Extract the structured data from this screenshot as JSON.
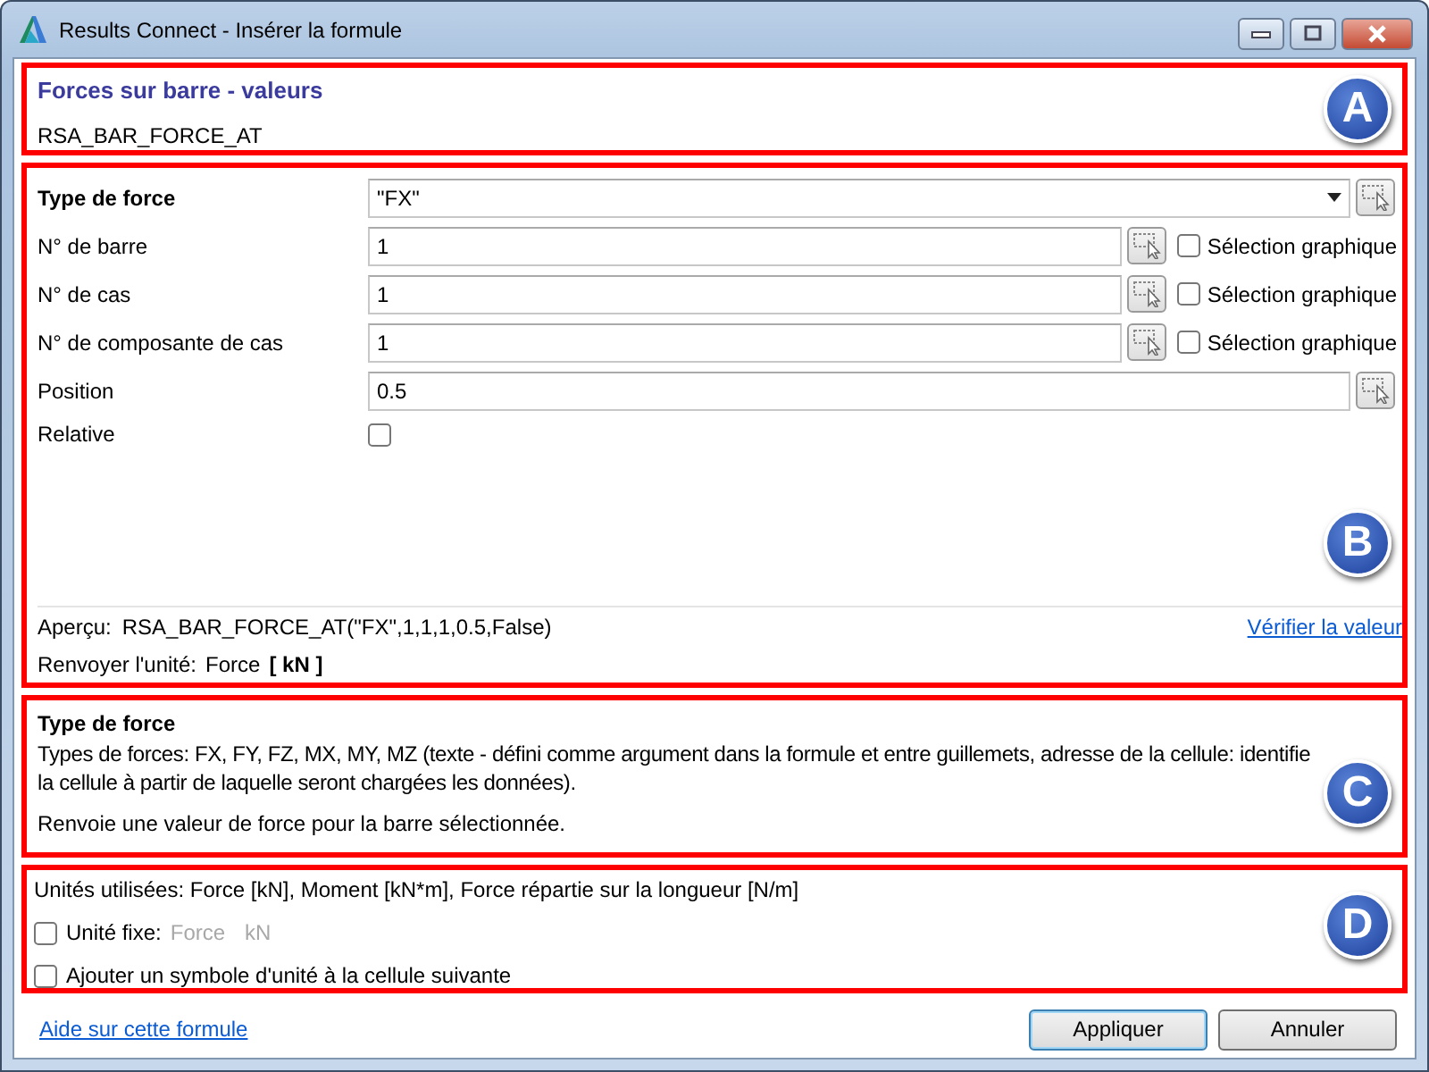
{
  "window": {
    "title": "Results Connect - Insérer la formule"
  },
  "header": {
    "title": "Forces sur barre - valeurs",
    "subtitle": "RSA_BAR_FORCE_AT",
    "callout": "A"
  },
  "parameters": {
    "callout": "B",
    "rows": [
      {
        "kind": "dropdown",
        "label": "Type de force",
        "value": "\"FX\""
      },
      {
        "kind": "field",
        "label": "N° de barre",
        "value": "1",
        "graphic_selection": {
          "label": "Sélection graphique",
          "checked": false
        }
      },
      {
        "kind": "field",
        "label": "N° de cas",
        "value": "1",
        "graphic_selection": {
          "label": "Sélection graphique",
          "checked": false
        }
      },
      {
        "kind": "field",
        "label": "N° de composante de cas",
        "value": "1",
        "graphic_selection": {
          "label": "Sélection graphique",
          "checked": false
        }
      },
      {
        "kind": "field",
        "label": "Position",
        "value": "0.5"
      },
      {
        "kind": "checkbox",
        "label": "Relative",
        "checked": false
      }
    ],
    "preview_label": "Aperçu:",
    "preview": "RSA_BAR_FORCE_AT(\"FX\",1,1,1,0.5,False)",
    "verify_link": "Vérifier la valeur",
    "unit_label": "Renvoyer l'unité:",
    "unit_name": "Force",
    "unit": "[ kN ]"
  },
  "description": {
    "callout": "C",
    "title": "Type de force",
    "text": "Types de forces: FX, FY, FZ, MX, MY, MZ (texte - défini comme argument dans la formule et entre guillemets, adresse de la cellule: identifie la cellule à partir de laquelle seront chargées les données).",
    "returns": "Renvoie une valeur de force pour la barre sélectionnée."
  },
  "units": {
    "callout": "D",
    "used": "Unités utilisées: Force [kN], Moment [kN*m], Force répartie sur la longueur [N/m]",
    "fixed_unit": {
      "label": "Unité fixe:",
      "checked": false,
      "disabled": true,
      "quantity": "Force",
      "unit": "kN"
    },
    "add_symbol": {
      "label": "Ajouter un symbole d'unité à la cellule suivante",
      "checked": false
    }
  },
  "footer": {
    "help_link": "Aide sur cette formule",
    "buttons": [
      {
        "label": "Appliquer",
        "default": true
      },
      {
        "label": "Annuler",
        "default": false
      }
    ]
  }
}
